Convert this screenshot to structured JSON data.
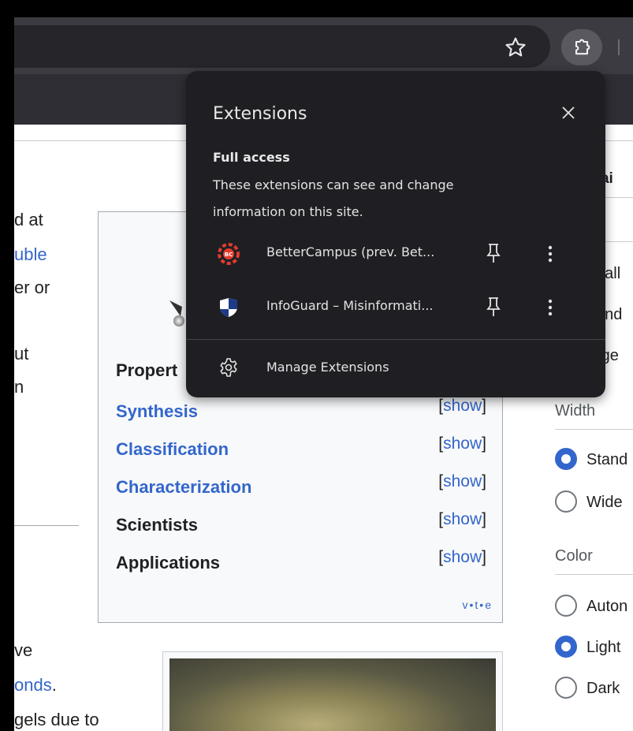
{
  "popup": {
    "title": "Extensions",
    "section_heading": "Full access",
    "section_desc": "These extensions can see and change information on this site.",
    "extensions": [
      {
        "name": "BetterCampus (prev. Bet...",
        "icon": "bettercampus-icon"
      },
      {
        "name": "InfoGuard – Misinformati...",
        "icon": "infoguard-shield-icon"
      }
    ],
    "manage_label": "Manage Extensions"
  },
  "left_fragments": [
    "d at",
    "uble",
    "er or",
    "ut",
    "n",
    "ve",
    "onds",
    ".",
    "gels due to"
  ],
  "infobox": {
    "partial_label": "Propert",
    "rows": [
      {
        "label": "Synthesis",
        "link": true,
        "show": "show"
      },
      {
        "label": "Classification",
        "link": true,
        "show": "show"
      },
      {
        "label": "Characterization",
        "link": true,
        "show": "show"
      },
      {
        "label": "Scientists",
        "link": false,
        "show": "show"
      },
      {
        "label": "Applications",
        "link": false,
        "show": "show"
      }
    ],
    "vte": "v•t•e",
    "bracket_open": "[",
    "bracket_close": "]"
  },
  "appearance": {
    "heading_partial": "arai",
    "text_options": [
      "nall",
      "and",
      "rge"
    ],
    "width_label": "Width",
    "width_options": [
      {
        "label": "Stand",
        "selected": true
      },
      {
        "label": "Wide",
        "selected": false
      }
    ],
    "color_label": "Color",
    "color_options": [
      {
        "label": "Auton",
        "selected": false
      },
      {
        "label": "Light",
        "selected": true
      },
      {
        "label": "Dark",
        "selected": false
      }
    ]
  },
  "colors": {
    "accent": "#3366cc",
    "popup_bg": "#1f1f23",
    "chrome_bg": "#3c3b42"
  }
}
